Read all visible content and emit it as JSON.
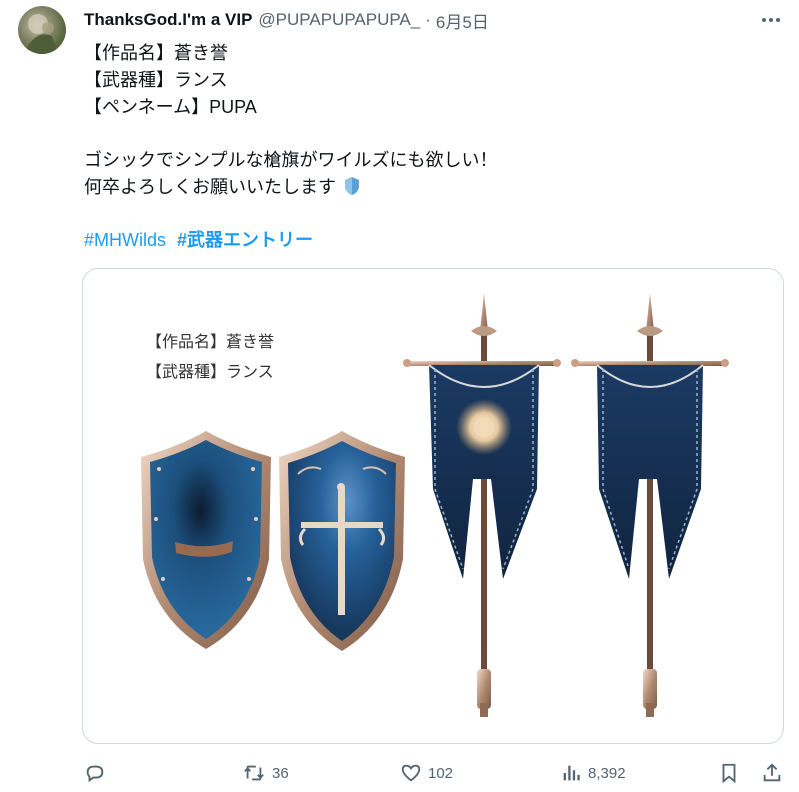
{
  "tweet": {
    "display_name": "ThanksGod.I'm a VIP",
    "handle": "@PUPAPUPAPUPA_",
    "separator": "·",
    "date": "6月5日",
    "lines": [
      "【作品名】蒼き誉",
      "【武器種】ランス",
      "【ペンネーム】PUPA",
      "ゴシックでシンプルな槍旗がワイルズにも欲しい！",
      "何卒よろしくお願いいたします"
    ],
    "hashtags": [
      "#MHWilds",
      "#武器エントリー"
    ]
  },
  "card": {
    "label_1": "【作品名】蒼き誉",
    "label_2": "【武器種】ランス"
  },
  "actions": {
    "retweets": "36",
    "likes": "102",
    "views": "8,392"
  },
  "icons": {
    "more": "more-icon",
    "reply": "reply-icon",
    "retweet": "retweet-icon",
    "like": "heart-icon",
    "views": "views-icon",
    "bookmark": "bookmark-icon",
    "share": "share-icon",
    "emoji": "shield-emoji-icon"
  },
  "colors": {
    "accent": "#1d9bf0",
    "secondary_text": "#536471",
    "shield_blue": "#1f5a8c",
    "banner_navy": "#142c4e",
    "metal": "#c9a085"
  }
}
